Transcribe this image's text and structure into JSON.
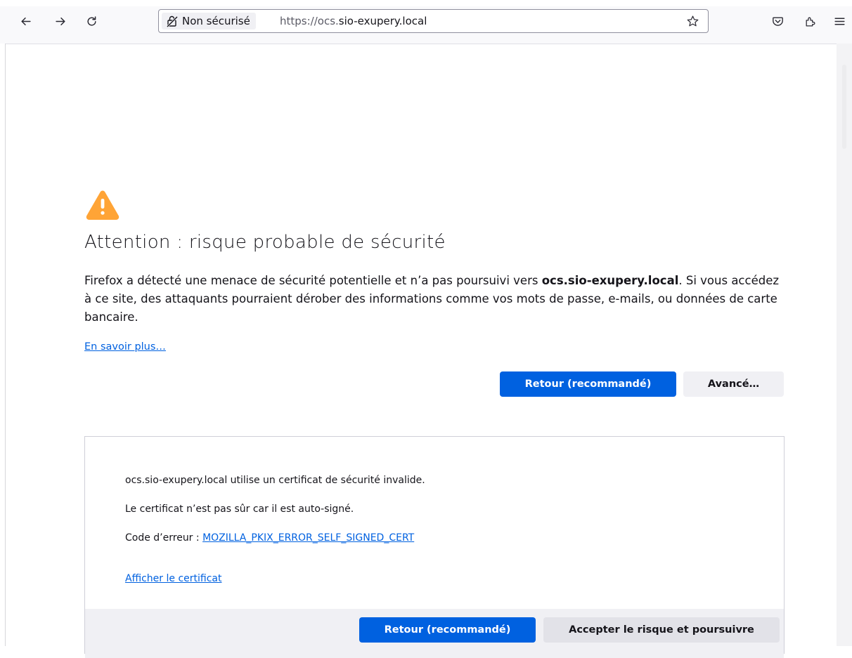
{
  "browser": {
    "identity_label": "Non sécurisé",
    "url_prefix": "https://ocs.",
    "url_host": "sio-exupery.local",
    "icons": {
      "back": "arrow-left-icon",
      "forward": "arrow-right-icon",
      "reload": "reload-icon",
      "identity": "insecure-lock-icon",
      "bookmark": "star-icon",
      "pocket": "pocket-icon",
      "extensions": "extensions-icon",
      "menu": "hamburger-menu-icon"
    }
  },
  "page": {
    "title": "Attention : risque probable de sécurité",
    "desc_part1": "Firefox a détecté une menace de sécurité potentielle et n’a pas poursuivi vers ",
    "desc_host": "ocs.sio-exupery.local",
    "desc_part2": ". Si vous accédez à ce site, des attaquants pourraient dérober des informations comme vos mots de passe, e-mails, ou données de carte bancaire.",
    "learn_more": "En savoir plus…",
    "back_button": "Retour (recommandé)",
    "advanced_button": "Avancé…",
    "warning_color": "#ffa436"
  },
  "advanced": {
    "line1": "ocs.sio-exupery.local utilise un certificat de sécurité invalide.",
    "line2": "Le certificat n’est pas sûr car il est auto-signé.",
    "error_label": "Code d’erreur : ",
    "error_code": "MOZILLA_PKIX_ERROR_SELF_SIGNED_CERT",
    "show_cert": "Afficher le certificat",
    "back_button": "Retour (recommandé)",
    "accept_button": "Accepter le risque et poursuivre"
  }
}
